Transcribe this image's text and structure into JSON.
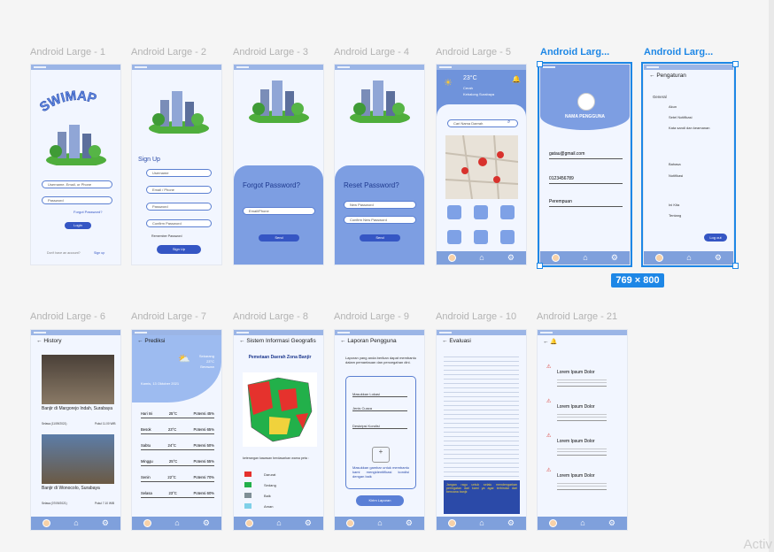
{
  "frames": [
    {
      "label": "Android Large - 1"
    },
    {
      "label": "Android Large - 2"
    },
    {
      "label": "Android Large - 3"
    },
    {
      "label": "Android Large - 4"
    },
    {
      "label": "Android Large - 5"
    },
    {
      "label": "Android Larg..."
    },
    {
      "label": "Android Larg..."
    },
    {
      "label": "Android Large - 6"
    },
    {
      "label": "Android Large - 7"
    },
    {
      "label": "Android Large - 8"
    },
    {
      "label": "Android Large - 9"
    },
    {
      "label": "Android Large - 10"
    },
    {
      "label": "Android Large - 21"
    }
  ],
  "selection_size": "769 × 800",
  "watermark": "Activ",
  "screen1": {
    "logo": "SWIMAP",
    "username": "Username, Email, or Phone",
    "password": "Password",
    "forgot": "Forgot Password?",
    "login": "Login",
    "signup_prompt": "Don't have an account?",
    "signup_link": "Sign up"
  },
  "screen2": {
    "title": "Sign Up",
    "fields": [
      "Username",
      "Email / Phone",
      "Password",
      "Confirm Password"
    ],
    "remember": "Remember Password",
    "button": "Sign Up"
  },
  "screen3": {
    "title": "Forgot Password?",
    "field": "Email/Phone",
    "button": "Send"
  },
  "screen4": {
    "title": "Reset Password?",
    "fields": [
      "New Password",
      "Confirm New Password"
    ],
    "button": "Send"
  },
  "screen5": {
    "temp": "23°C",
    "cond": "Cerah",
    "loc": "Kebalong Surabaya",
    "search": "Cari Nama Daerah"
  },
  "screen6": {
    "name": "NAMA PENGGUNA",
    "fields": [
      "gatau@gmail.com",
      "0123456789",
      "Perempuan"
    ]
  },
  "screen7": {
    "title": "Pengaturan",
    "section": "General",
    "items": [
      "Akun",
      "Setel Notifikasi",
      "Kata sandi dan keamanan",
      "Bahasa",
      "Notifikasi",
      "Ini Kita",
      "Tentang"
    ],
    "logout": "Log out"
  },
  "screen8": {
    "title": "History",
    "items": [
      {
        "title": "Banjir di Margorejo Indah, Surabaya",
        "date": "Selasa (11/09/2021)",
        "time": "Pukul 11.00 WIB"
      },
      {
        "title": "Banjir di Wonocolo, Surabaya",
        "date": "Selasa (07/09/2021)",
        "time": "Pukul 7.10 WIB"
      }
    ]
  },
  "screen9": {
    "title": "Prediksi",
    "now_label": "Sekarang",
    "now_temp": "23°C",
    "now_cond": "Berawan",
    "date": "Kamis, 13 Oktober 2021",
    "rows": [
      {
        "day": "Hari Ini",
        "temp": "25°C",
        "risk": "Potensi 45%"
      },
      {
        "day": "Besok",
        "temp": "23°C",
        "risk": "Potensi 65%"
      },
      {
        "day": "Sabtu",
        "temp": "24°C",
        "risk": "Potensi 50%"
      },
      {
        "day": "Minggu",
        "temp": "25°C",
        "risk": "Potensi 55%"
      },
      {
        "day": "Senin",
        "temp": "22°C",
        "risk": "Potensi 70%"
      },
      {
        "day": "Selasa",
        "temp": "23°C",
        "risk": "Potensi 60%"
      }
    ]
  },
  "screen10": {
    "title": "Sistem Informasi Geografis",
    "map_title": "Pemetaan Daerah Zona Banjir",
    "legend_intro": "keterangan kawasan berdasarkan warna peta :",
    "legend": [
      {
        "label": "Darurat",
        "color": "#e5322d"
      },
      {
        "label": "Sedang",
        "color": "#22b04a"
      },
      {
        "label": "Baik",
        "color": "#7f8f96"
      },
      {
        "label": "Aman",
        "color": "#7fd0e8"
      }
    ]
  },
  "screen11": {
    "title": "Laporan Pengguna",
    "intro": "Laporan yang anda berikan dapat membantu dalam pemantauan dan pencegahan dini.",
    "fields": [
      "Masukkan Lokasi",
      "Jenis Cuaca",
      "Deskripsi Kondisi"
    ],
    "photo_hint": "Masukkan gambar untuk membantu kami mengidentifikasi kondisi dengan baik",
    "button": "Kirim Laporan"
  },
  "screen12": {
    "title": "Evaluasi",
    "note": "Jangan ragu untuk selalu mendengarkan peringatan dari kami ya agar terhindar dari bencana banjir."
  },
  "screen13": {
    "items": [
      {
        "title": "Lorem Ipsum Dolor"
      },
      {
        "title": "Lorem Ipsum Dolor"
      },
      {
        "title": "Lorem Ipsum Dolor"
      },
      {
        "title": "Lorem Ipsum Dolor"
      }
    ]
  }
}
